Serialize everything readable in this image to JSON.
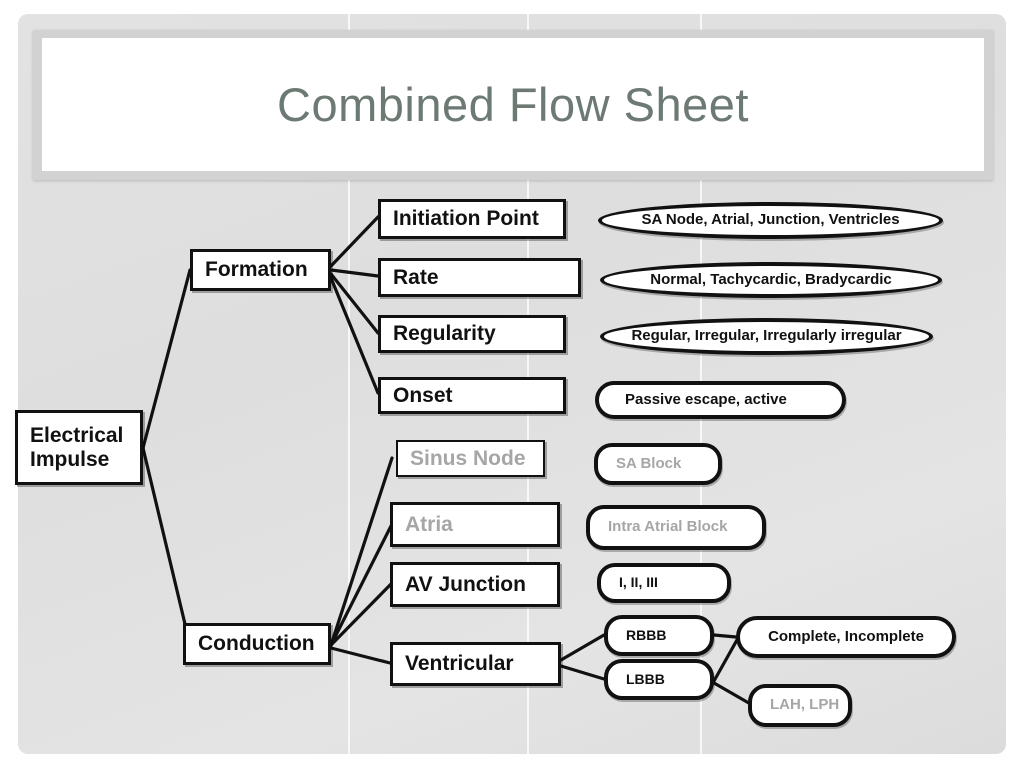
{
  "slide": {
    "title": "Combined Flow Sheet",
    "title_color": "#6d7a73",
    "background_color": "#e0e0e0",
    "outline_color": "#111111"
  },
  "nodes": {
    "root": {
      "line1": "Electrical",
      "line2": "Impulse"
    },
    "branch_formation": "Formation",
    "branch_conduction": "Conduction",
    "formation_children": [
      {
        "label": "Initiation Point",
        "dimmed": false,
        "value": "SA Node, Atrial, Junction, Ventricles",
        "value_dimmed": false
      },
      {
        "label": "Rate",
        "dimmed": false,
        "value": "Normal, Tachycardic, Bradycardic",
        "value_dimmed": false
      },
      {
        "label": "Regularity",
        "dimmed": false,
        "value": "Regular, Irregular, Irregularly irregular",
        "value_dimmed": false
      },
      {
        "label": "Onset",
        "dimmed": false,
        "value": "Passive escape, active",
        "value_dimmed": false
      }
    ],
    "conduction_children": [
      {
        "label": "Sinus Node",
        "dimmed": true,
        "value": "SA Block",
        "value_dimmed": true
      },
      {
        "label": "Atria",
        "dimmed": true,
        "value": "Intra Atrial Block",
        "value_dimmed": true
      },
      {
        "label": "AV Junction",
        "dimmed": false,
        "value": "I, II, III",
        "value_dimmed": false
      },
      {
        "label": "Ventricular",
        "dimmed": false,
        "value": null,
        "value_dimmed": false
      }
    ],
    "ventricular_children": [
      {
        "label": "RBBB",
        "dimmed": false
      },
      {
        "label": "LBBB",
        "dimmed": false
      }
    ],
    "bundle_results": [
      {
        "label": "Complete, Incomplete",
        "dimmed": false
      },
      {
        "label": "LAH, LPH",
        "dimmed": true
      }
    ]
  }
}
